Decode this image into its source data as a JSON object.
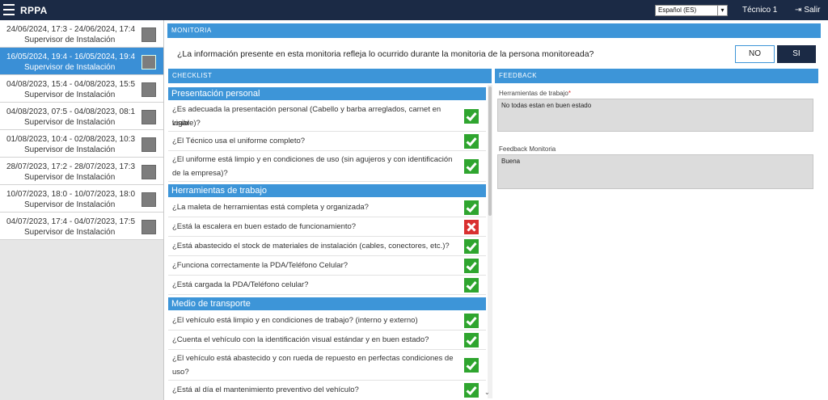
{
  "header": {
    "app_title": "RPPA",
    "language": "Español (ES)",
    "user": "Técnico 1",
    "logout": "Salir"
  },
  "sidebar": {
    "items": [
      {
        "dates": "24/06/2024, 17:3 - 24/06/2024, 17:4",
        "role": "Supervisor de Instalación"
      },
      {
        "dates": "16/05/2024, 19:4 - 16/05/2024, 19:4",
        "role": "Supervisor de Instalación"
      },
      {
        "dates": "04/08/2023, 15:4 - 04/08/2023, 15:5",
        "role": "Supervisor de Instalación"
      },
      {
        "dates": "04/08/2023, 07:5 - 04/08/2023, 08:1",
        "role": "Supervisor de Instalación"
      },
      {
        "dates": "01/08/2023, 10:4 - 02/08/2023, 10:3",
        "role": "Supervisor de Instalación"
      },
      {
        "dates": "28/07/2023, 17:2 - 28/07/2023, 17:3",
        "role": "Supervisor de Instalación"
      },
      {
        "dates": "10/07/2023, 18:0 - 10/07/2023, 18:0",
        "role": "Supervisor de Instalación"
      },
      {
        "dates": "04/07/2023, 17:4 - 04/07/2023, 17:5",
        "role": "Supervisor de Instalación"
      }
    ],
    "active_index": 1
  },
  "monitoria": {
    "title": "MONITORIA",
    "question": "¿La información presente en esta monitoria refleja lo ocurrido durante la monitoria de la persona monitoreada?",
    "no_label": "NO",
    "si_label": "SI",
    "selected": "SI"
  },
  "checklist": {
    "title": "CHECKLIST",
    "categories": [
      {
        "name": "Presentación personal",
        "items": [
          {
            "line1": "¿Es adecuada la presentación personal (Cabello y barba arreglados, carnet en lugar",
            "line2": "visible)?",
            "ok": true
          },
          {
            "line1": "¿El Técnico usa el uniforme completo?",
            "line2": "",
            "ok": true
          },
          {
            "line1": "¿El uniforme está limpio y en condiciones de uso (sin agujeros y con identificación",
            "line2": "de la empresa)?",
            "ok": true
          }
        ]
      },
      {
        "name": "Herramientas de trabajo",
        "items": [
          {
            "line1": "¿La maleta de herramientas está completa y organizada?",
            "line2": "",
            "ok": true
          },
          {
            "line1": "¿Está la escalera en buen estado de funcionamiento?",
            "line2": "",
            "ok": false
          },
          {
            "line1": "¿Está abastecido el stock de materiales de instalación (cables, conectores, etc.)?",
            "line2": "",
            "ok": true
          },
          {
            "line1": "¿Funciona correctamente la PDA/Teléfono Celular?",
            "line2": "",
            "ok": true
          },
          {
            "line1": "¿Está cargada la PDA/Teléfono celular?",
            "line2": "",
            "ok": true
          }
        ]
      },
      {
        "name": "Medio de transporte",
        "items": [
          {
            "line1": "¿El vehículo está limpio y en condiciones de trabajo? (interno y externo)",
            "line2": "",
            "ok": true
          },
          {
            "line1": "¿Cuenta el vehículo con la identificación visual estándar y en buen estado?",
            "line2": "",
            "ok": true
          },
          {
            "line1": "¿El vehículo está abastecido y con rueda de repuesto en perfectas condiciones de",
            "line2": "uso?",
            "ok": true
          },
          {
            "line1": "¿Está al día el mantenimiento preventivo del vehículo?",
            "line2": "",
            "ok": true
          }
        ]
      }
    ]
  },
  "feedback": {
    "title": "FEEDBACK",
    "tools_label": "Herramientas de trabajo",
    "tools_required": "*",
    "tools_value": "No todas estan en buen estado",
    "monitoria_label": "Feedback Monitoria",
    "monitoria_value": "Buena"
  },
  "colors": {
    "topbar": "#1b2a45",
    "accent": "#3d95d8",
    "ok": "#2fa52f",
    "bad": "#d93030"
  }
}
